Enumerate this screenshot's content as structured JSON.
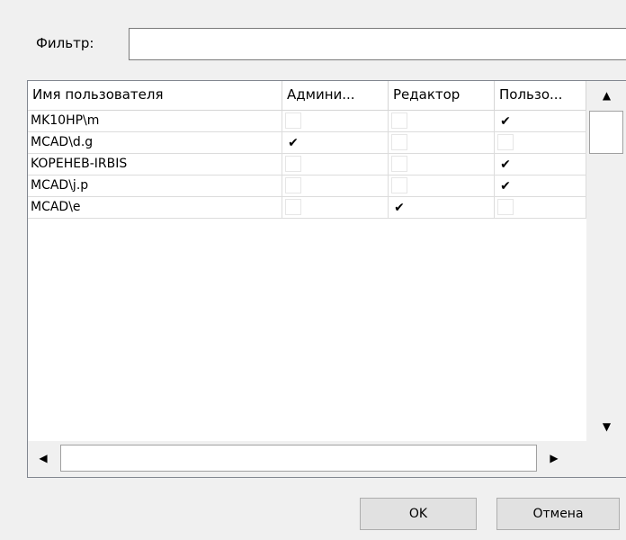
{
  "filter": {
    "label": "Фильтр:",
    "value": "",
    "placeholder": ""
  },
  "columns": [
    "Имя пользователя",
    "Админи...",
    "Редактор",
    "Пользо..."
  ],
  "rows": [
    {
      "name": "MK10HP\\m",
      "admin": false,
      "editor": false,
      "user": true
    },
    {
      "name": "MCAD\\d.g",
      "admin": true,
      "editor": false,
      "user": false
    },
    {
      "name": "KOPEHEB-IRBIS",
      "admin": false,
      "editor": false,
      "user": true
    },
    {
      "name": "MCAD\\j.p",
      "admin": false,
      "editor": false,
      "user": true
    },
    {
      "name": "MCAD\\e",
      "admin": false,
      "editor": true,
      "user": false
    }
  ],
  "icons": {
    "check": "✔",
    "scroll_up": "▲",
    "scroll_down": "▼",
    "scroll_left": "◀",
    "scroll_right": "▶"
  },
  "buttons": {
    "ok": "OK",
    "cancel": "Отмена"
  }
}
